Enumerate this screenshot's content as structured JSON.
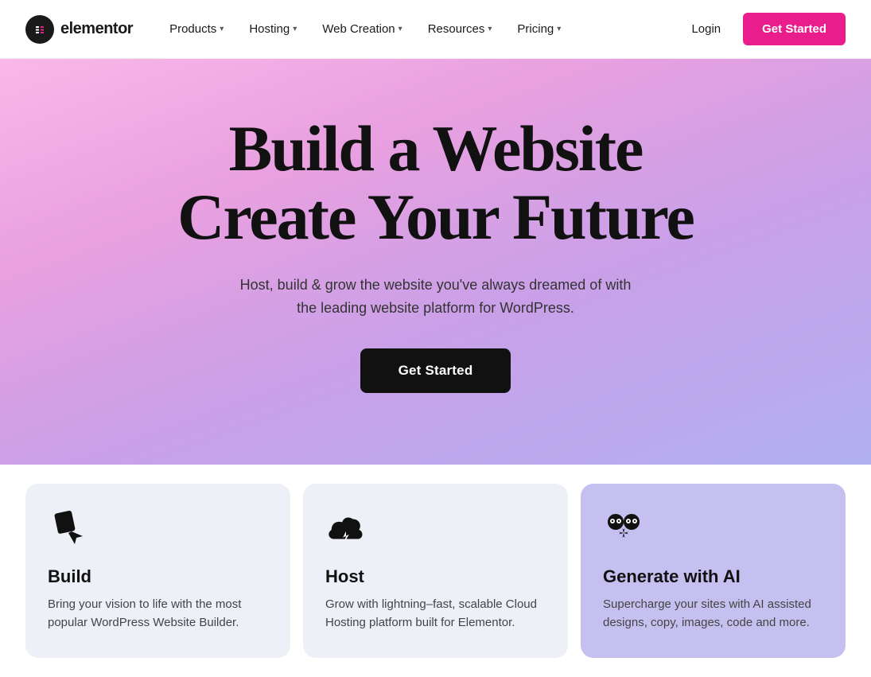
{
  "logo": {
    "symbol": "e",
    "name": "elementor"
  },
  "nav": {
    "items": [
      {
        "label": "Products",
        "hasDropdown": true
      },
      {
        "label": "Hosting",
        "hasDropdown": true
      },
      {
        "label": "Web Creation",
        "hasDropdown": true
      },
      {
        "label": "Resources",
        "hasDropdown": true
      },
      {
        "label": "Pricing",
        "hasDropdown": true
      }
    ],
    "login_label": "Login",
    "get_started_label": "Get Started"
  },
  "hero": {
    "title_line1": "Build a Website",
    "title_line2": "Create Your Future",
    "subtitle": "Host, build & grow the website you've always dreamed of with the leading website platform for WordPress.",
    "cta_label": "Get Started"
  },
  "cards": [
    {
      "id": "build",
      "icon": "cursor-icon",
      "title": "Build",
      "description": "Bring your vision to life with the most popular WordPress Website Builder."
    },
    {
      "id": "host",
      "icon": "cloud-icon",
      "title": "Host",
      "description": "Grow with lightning–fast, scalable Cloud Hosting platform built for Elementor."
    },
    {
      "id": "ai",
      "icon": "ai-sparkle-icon",
      "title": "Generate with AI",
      "description": "Supercharge your sites with AI assisted designs, copy, images, code and more."
    }
  ]
}
